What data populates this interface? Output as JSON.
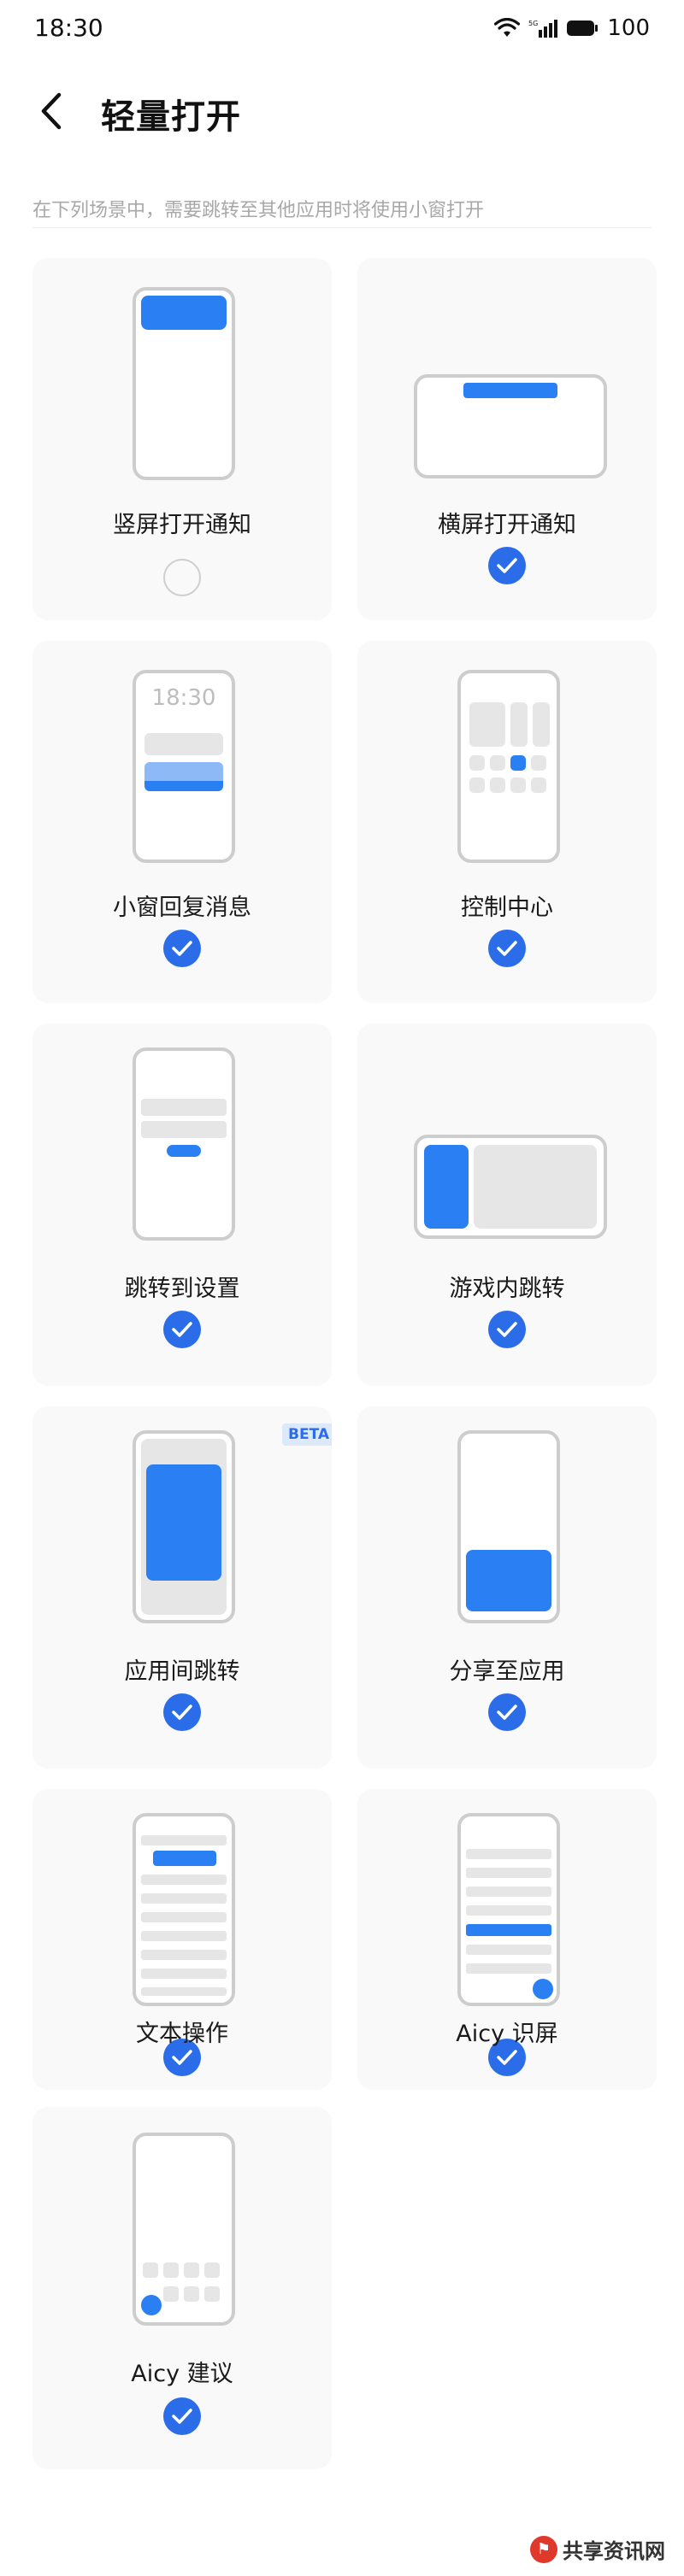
{
  "status": {
    "time": "18:30",
    "battery": "100"
  },
  "header": {
    "title": "轻量打开"
  },
  "hint": "在下列场景中，需要跳转至其他应用时将使用小窗打开",
  "cards": [
    {
      "label": "竖屏打开通知",
      "checked": false
    },
    {
      "label": "横屏打开通知",
      "checked": true
    },
    {
      "label": "小窗回复消息",
      "checked": true,
      "preview_time": "18:30"
    },
    {
      "label": "控制中心",
      "checked": true
    },
    {
      "label": "跳转到设置",
      "checked": true
    },
    {
      "label": "游戏内跳转",
      "checked": true
    },
    {
      "label": "应用间跳转",
      "checked": true,
      "badge": "BETA"
    },
    {
      "label": "分享至应用",
      "checked": true
    },
    {
      "label": "文本操作",
      "checked": true
    },
    {
      "label": "Aicy 识屏",
      "checked": true
    },
    {
      "label": "Aicy 建议",
      "checked": true
    }
  ],
  "watermark": {
    "text": "共享资讯网"
  },
  "colors": {
    "accent": "#2b6de8",
    "illustration_blue": "#2a7ff3",
    "card_bg": "#f9f9f9"
  }
}
